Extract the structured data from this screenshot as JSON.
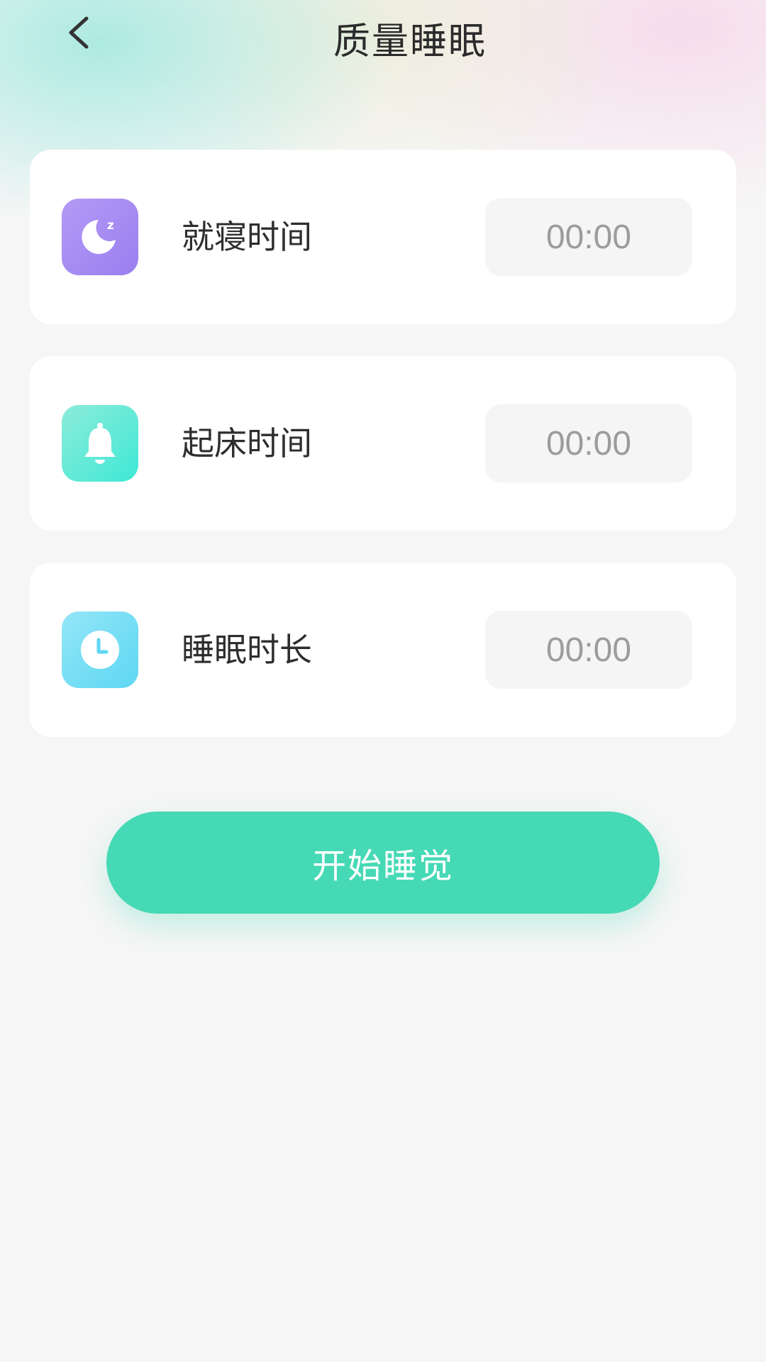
{
  "header": {
    "title": "质量睡眠",
    "back_icon": "chevron-left-icon"
  },
  "rows": [
    {
      "label": "就寝时间",
      "value": "00:00",
      "icon": "moon-icon",
      "color": "#a58bf3"
    },
    {
      "label": "起床时间",
      "value": "00:00",
      "icon": "bell-icon",
      "color": "#4ce8d6"
    },
    {
      "label": "睡眠时长",
      "value": "00:00",
      "icon": "clock-icon",
      "color": "#68dbf3"
    }
  ],
  "start_button": {
    "label": "开始睡觉",
    "color": "#46d9b5"
  }
}
